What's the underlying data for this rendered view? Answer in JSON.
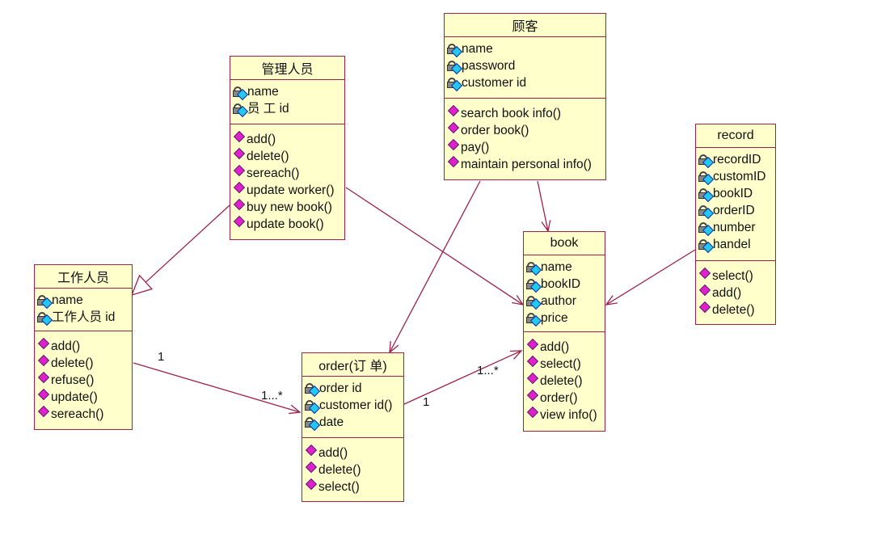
{
  "classes": [
    {
      "id": "customer",
      "name": "顾客",
      "attributes": [
        "name",
        "password",
        "customer id"
      ],
      "operations": [
        "search book info()",
        "order book()",
        "pay()",
        "maintain personal info()"
      ]
    },
    {
      "id": "manager",
      "name": "管理人员",
      "attributes": [
        "name",
        "员 工 id"
      ],
      "operations": [
        "add()",
        "delete()",
        "sereach()",
        "update worker()",
        "buy new book()",
        "update book()"
      ]
    },
    {
      "id": "record",
      "name": "record",
      "attributes": [
        "recordID",
        "customID",
        "bookID",
        "orderID",
        "number",
        "handel"
      ],
      "operations": [
        "select()",
        "add()",
        "delete()"
      ]
    },
    {
      "id": "book",
      "name": "book",
      "attributes": [
        "name",
        "bookID",
        "author",
        "price"
      ],
      "operations": [
        "add()",
        "select()",
        "delete()",
        "order()",
        "view info()"
      ]
    },
    {
      "id": "worker",
      "name": "工作人员",
      "attributes": [
        "name",
        "工作人员 id"
      ],
      "operations": [
        "add()",
        "delete()",
        "refuse()",
        "update()",
        "sereach()"
      ]
    },
    {
      "id": "order",
      "name": "order(订 单)",
      "attributes": [
        "order id",
        "customer id()",
        "date"
      ],
      "operations": [
        "add()",
        "delete()",
        "select()"
      ]
    }
  ],
  "relations": [
    {
      "from": "manager",
      "to": "worker",
      "type": "generalization"
    },
    {
      "from": "manager",
      "to": "book",
      "type": "association"
    },
    {
      "from": "customer",
      "to": "book",
      "type": "association"
    },
    {
      "from": "customer",
      "to": "order",
      "type": "association"
    },
    {
      "from": "record",
      "to": "book",
      "type": "association"
    },
    {
      "from": "worker",
      "to": "order",
      "type": "association",
      "source_multiplicity": "1",
      "target_multiplicity": "1...*"
    },
    {
      "from": "order",
      "to": "book",
      "type": "association",
      "source_multiplicity": "1",
      "target_multiplicity": "1...*"
    }
  ],
  "colors": {
    "border": "#a0204a",
    "fill": "#ffffcc",
    "edge": "#a0204a"
  }
}
